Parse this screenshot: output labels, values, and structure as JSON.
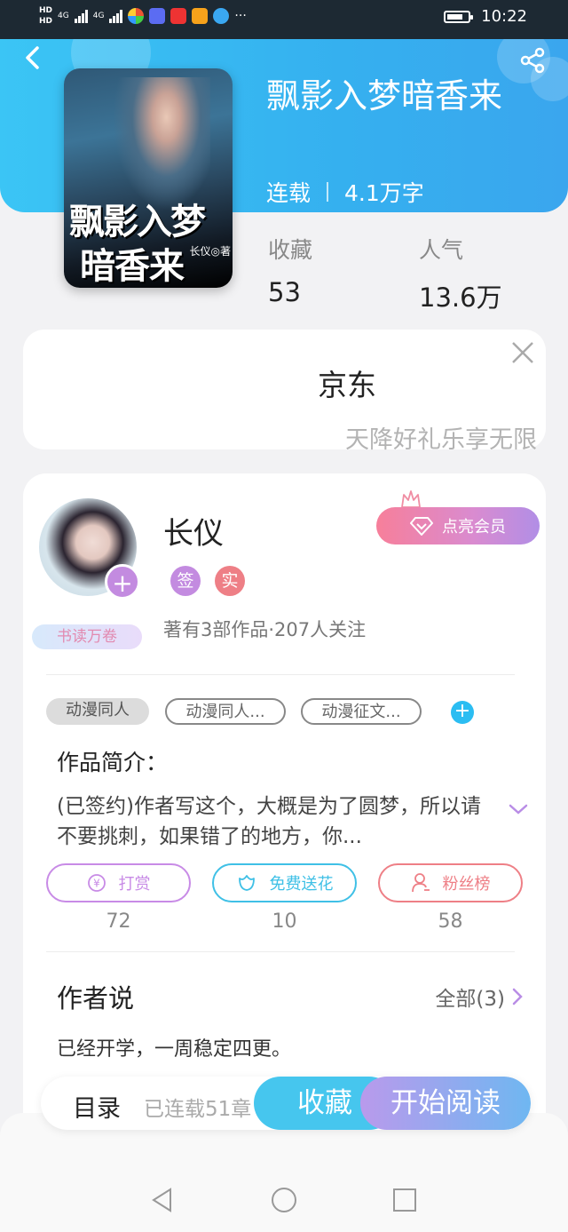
{
  "status_bar": {
    "hd1": "HD",
    "hd2": "HD",
    "net1": "4G",
    "net2": "4G",
    "more": "···",
    "time": "10:22",
    "battery_level": 0.75
  },
  "header": {
    "title": "飘影入梦暗香来",
    "status": "连载",
    "word_count": "4.1万字"
  },
  "cover": {
    "title_line1": "飘影入梦",
    "title_line2": "暗香来",
    "author": "长仪◎著"
  },
  "stats": {
    "favorites_label": "收藏",
    "favorites_value": "53",
    "popularity_label": "人气",
    "popularity_value": "13.6万"
  },
  "ad": {
    "brand": "京东",
    "slogan": "天降好礼乐享无限"
  },
  "author": {
    "name": "长仪",
    "badge_sign": "签",
    "badge_real": "实",
    "reader_badge": "书读万卷",
    "works_summary": "著有3部作品·207人关注",
    "vip_button": "点亮会员"
  },
  "tags": [
    "动漫同人",
    "动漫同人...",
    "动漫征文..."
  ],
  "intro": {
    "title": "作品简介：",
    "text": "(已签约)作者写这个，大概是为了圆梦，所以请不要挑刺，如果错了的地方，你..."
  },
  "actions": [
    {
      "label": "打赏",
      "count": "72",
      "color": "#c88be6"
    },
    {
      "label": "免费送花",
      "count": "10",
      "color": "#3fc0e6"
    },
    {
      "label": "粉丝榜",
      "count": "58",
      "color": "#ee7f86"
    }
  ],
  "author_says": {
    "title": "作者说",
    "all_link": "全部(3)",
    "text": "已经开学，一周稳定四更。"
  },
  "bottom_bar": {
    "toc": "目录",
    "progress": "已连载51章",
    "collect": "收藏",
    "read": "开始阅读"
  },
  "colors": {
    "header": "#3bb6f2",
    "accent_purple": "#c38be0",
    "accent_blue": "#2bbdf2"
  }
}
